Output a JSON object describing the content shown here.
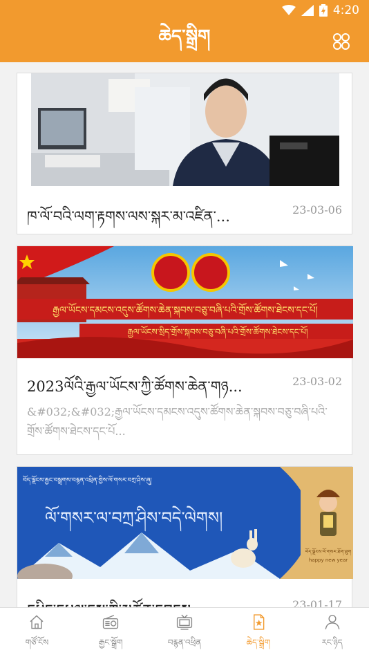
{
  "status_bar": {
    "time": "4:20"
  },
  "header": {
    "title": "ཆེད་སྒྲིག"
  },
  "articles": [
    {
      "title": "ཁ་ལོ་བའི་ལག་རྟགས་ལས་སྐར་མ་འཛིན་...",
      "date": "23-03-06",
      "summary": ""
    },
    {
      "title": "2023ལོའི་རྒྱལ་ཡོངས་ཀྱི་ཚོགས་ཆེན་གཉ...",
      "date": "23-03-02",
      "summary": "&#032;&#032;རྒྱལ་ཡོངས་དམངས་འདུས་ཚོགས་ཆེན་སྐབས་བཅུ་བཞི་པའི་གྲོས་ཚོགས་ཐེངས་དང་པོ..."
    },
    {
      "title": "དཔྱིད་དཔལ་དུས་ཀྱི་མཚོན་དབྱངས",
      "date": "23-01-17",
      "summary": ""
    }
  ],
  "banner": {
    "line1": "རྒྱལ་ཡོངས་དམངས་འདུས་ཚོགས་ཆེན་སྐབས་བཅུ་བཞི་པའི་གྲོས་ཚོགས་ཐེངས་དང་པོ།",
    "line2": "རྒྱལ་ཡོངས་སྲིད་གྲོས་སྐབས་བཅུ་བཞི་པའི་གྲོས་ཚོགས་ཐེངས་དང་པོ།"
  },
  "newyear": {
    "top_text": "བོད་ལྗོངས་རྒྱང་བསྒྲགས་བརྙན་འཕྲིན་གྱིས་ལོ་གསར་བཀྲ་ཤིས་ཞུ།",
    "calligraphy": "ལོ་གསར་ལ་བཀྲ་ཤིས་བདེ་ལེགས།",
    "side_text": "བོད་ལྗོངས་ལོ་གསར་ཐོག་ཐུག",
    "side_sub": "happy new year"
  },
  "tabs": [
    {
      "label": "གཙོ་ངོས",
      "icon": "home-icon"
    },
    {
      "label": "རྒྱང་སྒྲོག",
      "icon": "radio-icon"
    },
    {
      "label": "བརྙན་འཕྲིན",
      "icon": "tv-icon"
    },
    {
      "label": "ཆེད་སྒྲིག",
      "icon": "star-doc-icon"
    },
    {
      "label": "རང་ཉིད",
      "icon": "person-icon"
    }
  ],
  "colors": {
    "accent": "#f29a2e"
  }
}
